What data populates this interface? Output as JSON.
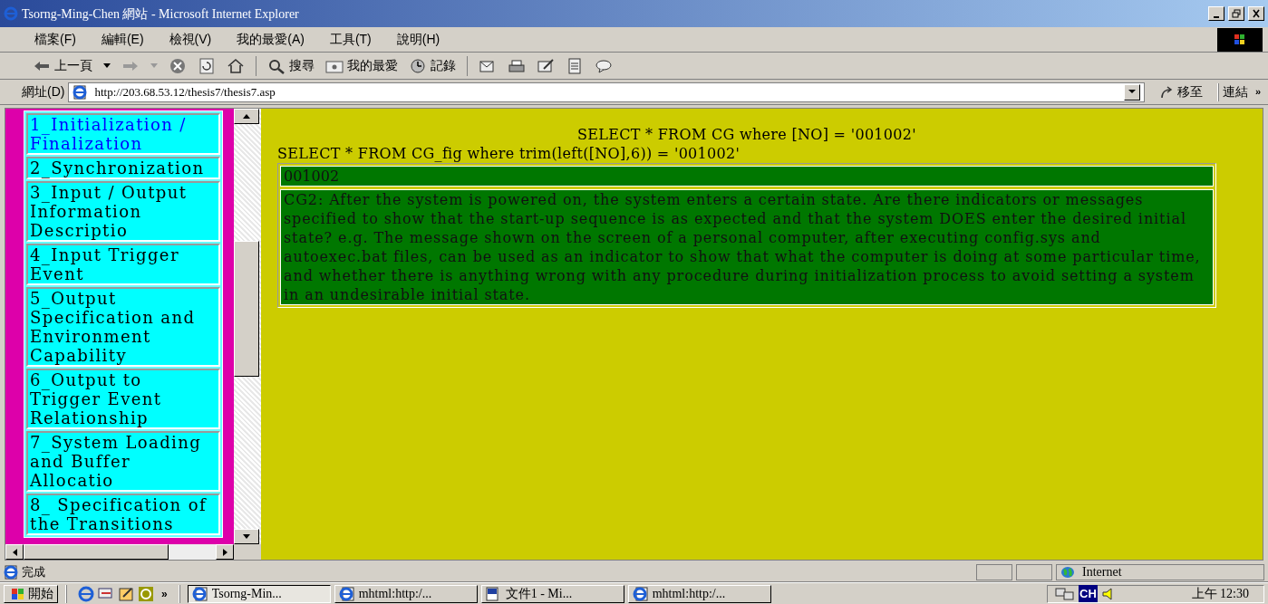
{
  "window": {
    "title": "Tsorng-Ming-Chen 網站 - Microsoft Internet Explorer"
  },
  "menu": [
    "檔案(F)",
    "編輯(E)",
    "檢視(V)",
    "我的最愛(A)",
    "工具(T)",
    "說明(H)"
  ],
  "toolbar": {
    "back": "上一頁",
    "search": "搜尋",
    "favorites": "我的最愛",
    "history": "記錄"
  },
  "address": {
    "label": "網址(D)",
    "value": "http://203.68.53.12/thesis7/thesis7.asp",
    "go": "移至",
    "links": "連結",
    "chevron": "»"
  },
  "sidebar": {
    "items": [
      {
        "label": "1_Initialization / Finalization",
        "selected": true
      },
      {
        "label": "2_Synchronization",
        "selected": false
      },
      {
        "label": "3_Input / Output Information Descriptio",
        "selected": false
      },
      {
        "label": "4_Input Trigger Event",
        "selected": false
      },
      {
        "label": "5_Output Specification and Environment Capability",
        "selected": false
      },
      {
        "label": "6_Output to Trigger Event Relationship",
        "selected": false
      },
      {
        "label": "7_System Loading and Buffer Allocatio",
        "selected": false
      },
      {
        "label": "8_ Specification of the Transitions",
        "selected": false
      }
    ]
  },
  "content": {
    "queries": [
      "SELECT * FROM CG where [NO] = '001002'",
      "SELECT * FROM CG_fig where trim(left([NO],6)) = '001002'"
    ],
    "table": {
      "id": "001002",
      "description": "CG2: After the system is powered on, the system enters a certain state. Are there indicators or messages specified to show that the start-up sequence is as expected and that the system DOES enter the desired initial state? e.g. The message shown on the screen of a personal computer, after executing config.sys and autoexec.bat files, can be used as an indicator to show that what the computer is doing at some particular time, and whether there is anything wrong with any procedure during initialization process to avoid setting a system in an undesirable initial state."
    }
  },
  "status_bar": {
    "text": "完成",
    "zone": "Internet"
  },
  "taskbar": {
    "start": "開始",
    "more": "»",
    "tasks": [
      "Tsorng-Min...",
      "mhtml:http:/...",
      "文件1 - Mi...",
      "mhtml:http:/..."
    ],
    "ime": "CH",
    "clock": "上午 12:30"
  }
}
